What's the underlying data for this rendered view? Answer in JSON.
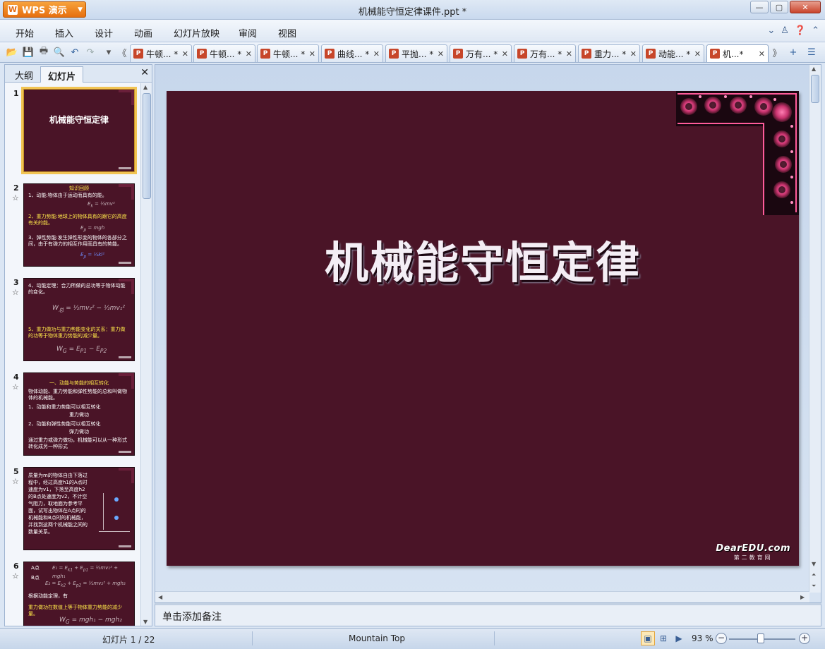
{
  "app": {
    "name": "WPS 演示",
    "title": "机械能守恒定律课件.ppt *"
  },
  "window_controls": {
    "minimize": "▭",
    "maximize": "▢",
    "close": "✕"
  },
  "menu": [
    "开始",
    "插入",
    "设计",
    "动画",
    "幻灯片放映",
    "审阅",
    "视图"
  ],
  "menu_right": {
    "shirt": "👕",
    "help": "?"
  },
  "doc_tabs": [
    {
      "label": "牛顿... *"
    },
    {
      "label": "牛顿... *"
    },
    {
      "label": "牛顿... *"
    },
    {
      "label": "曲线... *"
    },
    {
      "label": "平抛... *"
    },
    {
      "label": "万有... *"
    },
    {
      "label": "万有... *"
    },
    {
      "label": "重力... *"
    },
    {
      "label": "动能... *"
    },
    {
      "label": "机...*"
    }
  ],
  "left_pane": {
    "tabs": [
      "大纲",
      "幻灯片"
    ],
    "thumbnails": [
      {
        "num": "1",
        "title": "机械能守恒定律"
      },
      {
        "num": "2",
        "lines": [
          "知识回顾",
          "1、动能:物体由于运动而具有的能。",
          "2、重力势能:地球上的物体具有的跟它的高度有关的能。",
          "3、弹性势能:发生弹性形变的物体的各部分之间，由于有弹力的相互作用而具有的势能。"
        ]
      },
      {
        "num": "3",
        "lines": [
          "4、动能定理：合力所做的总功等于物体动能的变化。",
          "5、重力做功与重力势能变化的关系：重力做的功等于物体重力势能的减少量。"
        ]
      },
      {
        "num": "4",
        "lines": [
          "一、动能与势能的相互转化",
          "物体动能、重力势能和弹性势能的总和叫做物体的机械能。",
          "1、动能和重力势能可以相互转化",
          "重力做功",
          "2、动能和弹性势能可以相互转化",
          "弹力做功",
          "通过重力或弹力做功，机械能可以从一种形式转化成另一种形式"
        ]
      },
      {
        "num": "5",
        "lines": [
          "质量为m的物体自由下落过程中，经过高度h1的A点时速度为v1，下落至高度h2的B点处速度为v2，不计空气阻力，取地面为参考平面，试写出物体在A点时的机械能和B点时的机械能，并找到这两个机械能之间的数量关系。"
        ]
      },
      {
        "num": "6",
        "lines": [
          "A点",
          "B点",
          "根据动能定理，有",
          "重力做功在数值上等于物体重力势能的减少量。"
        ]
      }
    ],
    "star": "☆"
  },
  "slide": {
    "title": "机械能守恒定律",
    "watermark_main": "DearEDU.com",
    "watermark_sub": "第二教育网"
  },
  "notes": {
    "placeholder": "单击添加备注"
  },
  "status": {
    "slide_count": "幻灯片 1 / 22",
    "theme": "Mountain Top",
    "zoom": "93 %"
  }
}
